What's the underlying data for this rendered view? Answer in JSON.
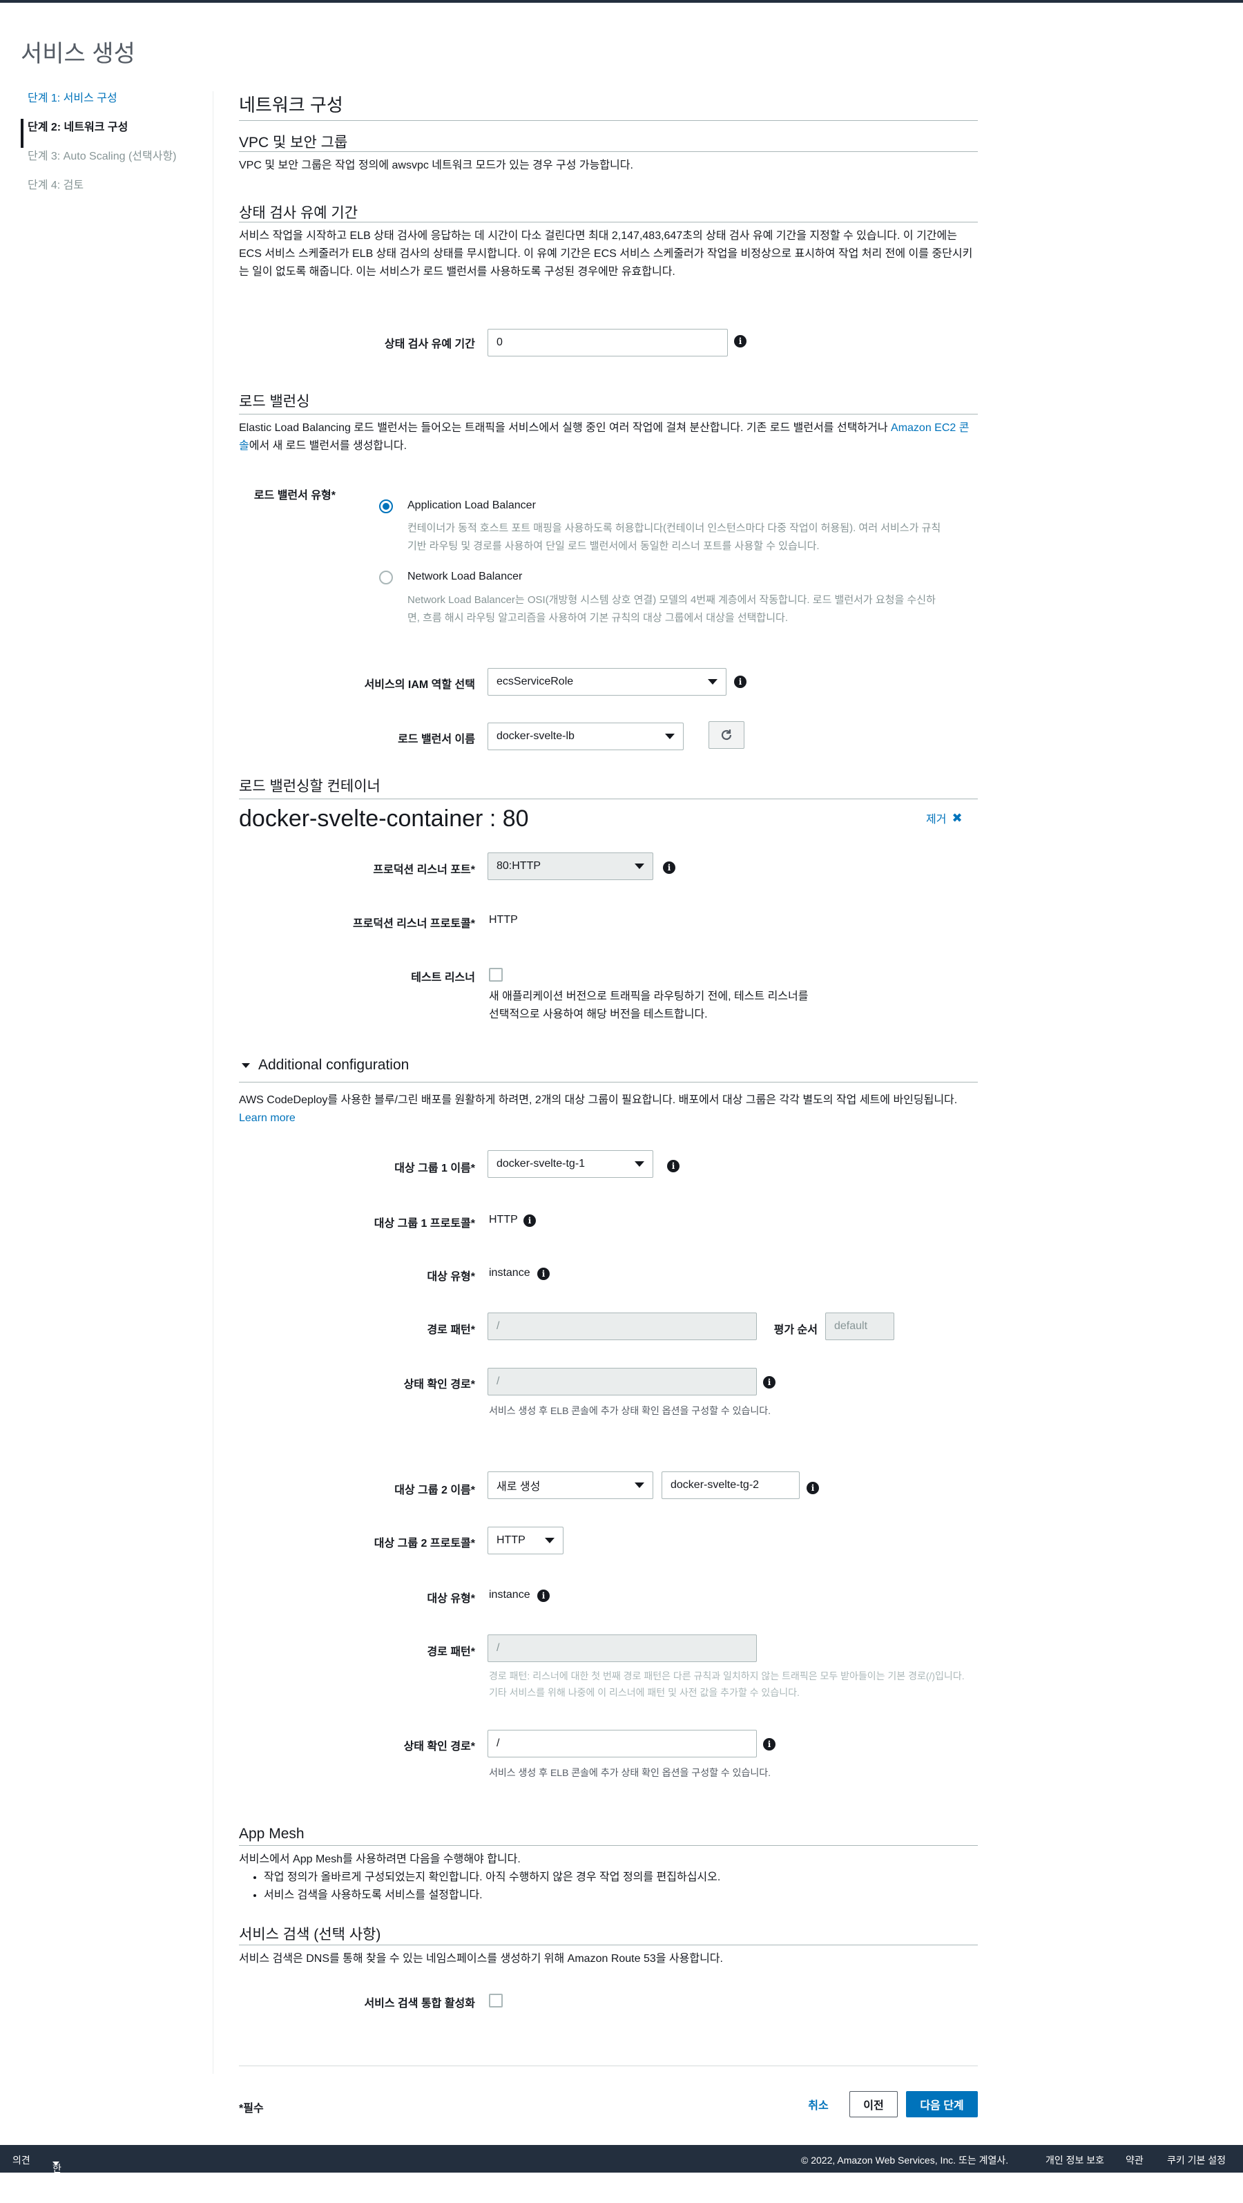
{
  "page_title": "서비스 생성",
  "steps": [
    {
      "label": "단계 1: 서비스 구성"
    },
    {
      "label": "단계 2: 네트워크 구성"
    },
    {
      "label": "단계 3: Auto Scaling (선택사항)"
    },
    {
      "label": "단계 4: 검토"
    }
  ],
  "section_title": "네트워크 구성",
  "vpc": {
    "title": "VPC 및 보안 그룹",
    "desc": "VPC 및 보안 그룹은 작업 정의에 awsvpc 네트워크 모드가 있는 경우 구성 가능합니다."
  },
  "grace": {
    "title": "상태 검사 유예 기간",
    "desc": "서비스 작업을 시작하고 ELB 상태 검사에 응답하는 데 시간이 다소 걸린다면 최대 2,147,483,647초의 상태 검사 유예 기간을 지정할 수 있습니다. 이 기간에는 ECS 서비스 스케줄러가 ELB 상태 검사의 상태를 무시합니다. 이 유예 기간은 ECS 서비스 스케줄러가 작업을 비정상으로 표시하여 작업 처리 전에 이를 중단시키는 일이 없도록 해줍니다. 이는 서비스가 로드 밸런서를 사용하도록 구성된 경우에만 유효합니다.",
    "label": "상태 검사 유예 기간",
    "value": "0",
    "info_icon": "info-icon"
  },
  "lb": {
    "title": "로드 밸런싱",
    "desc_pre": "Elastic Load Balancing 로드 밸런서는 들어오는 트래픽을 서비스에서 실행 중인 여러 작업에 걸쳐 분산합니다. 기존 로드 밸런서를 선택하거나 ",
    "desc_link": "Amazon EC2 콘솔",
    "desc_post": "에서 새 로드 밸런서를 생성합니다.",
    "type_label": "로드 밸런서 유형*",
    "options": [
      {
        "label": "Application Load Balancer",
        "desc": "컨테이너가 동적 호스트 포트 매핑을 사용하도록 허용합니다(컨테이너 인스턴스마다 다중 작업이 허용됨). 여러 서비스가 규칙 기반 라우팅 및 경로를 사용하여 단일 로드 밸런서에서 동일한 리스너 포트를 사용할 수 있습니다.",
        "selected": true
      },
      {
        "label": "Network Load Balancer",
        "desc": "Network Load Balancer는 OSI(개방형 시스템 상호 연결) 모델의 4번째 계층에서 작동합니다. 로드 밸런서가 요청을 수신하면, 흐름 해시 라우팅 알고리즘을 사용하여 기본 규칙의 대상 그룹에서 대상을 선택합니다.",
        "selected": false
      }
    ],
    "iam_label": "서비스의 IAM 역할 선택",
    "iam_value": "ecsServiceRole",
    "name_label": "로드 밸런서 이름",
    "name_value": "docker-svelte-lb",
    "refresh_icon": "refresh-icon"
  },
  "container": {
    "section_title": "로드 밸런싱할 컨테이너",
    "name": "docker-svelte-container : 80",
    "remove_label": "제거",
    "prod_port_label": "프로덕션 리스너 포트*",
    "prod_port_value": "80:HTTP",
    "prod_proto_label": "프로덕션 리스너 프로토콜*",
    "prod_proto_value": "HTTP",
    "test_listener_label": "테스트 리스너",
    "test_listener_help": "새 애플리케이션 버전으로 트래픽을 라우팅하기 전에, 테스트 리스너를 선택적으로 사용하여 해당 버전을 테스트합니다."
  },
  "additional": {
    "title": "Additional configuration",
    "desc": "AWS CodeDeploy를 사용한 블루/그린 배포를 원활하게 하려면, 2개의 대상 그룹이 필요합니다. 배포에서 대상 그룹은 각각 별도의 작업 세트에 바인딩됩니다.",
    "learn_more": "Learn more",
    "tg1_name_label": "대상 그룹 1 이름*",
    "tg1_name_value": "docker-svelte-tg-1",
    "tg1_proto_label": "대상 그룹 1 프로토콜*",
    "tg1_proto_value": "HTTP",
    "target_type_label": "대상 유형*",
    "target_type_value": "instance",
    "path_label": "경로 패턴*",
    "path_value": "/",
    "eval_label": "평가 순서",
    "eval_value": "default",
    "health_label": "상태 확인 경로*",
    "health_value": "/",
    "health_help": "서비스 생성 후 ELB 콘솔에 추가 상태 확인 옵션을 구성할 수 있습니다.",
    "tg2_name_label": "대상 그룹 2 이름*",
    "tg2_select_value": "새로 생성",
    "tg2_name_value": "docker-svelte-tg-2",
    "tg2_proto_label": "대상 그룹 2 프로토콜*",
    "tg2_proto_value": "HTTP",
    "target_type2_label": "대상 유형*",
    "target_type2_value": "instance",
    "path2_label": "경로 패턴*",
    "path2_value": "/",
    "path2_help": "경로 패턴: 리스너에 대한 첫 번째 경로 패턴은 다른 규칙과 일치하지 않는 트래픽은 모두 받아들이는 기본 경로(/)입니다. 기타 서비스를 위해 나중에 이 리스너에 패턴 및 사전 값을 추가할 수 있습니다.",
    "health2_label": "상태 확인 경로*",
    "health2_value": "/",
    "health2_help": "서비스 생성 후 ELB 콘솔에 추가 상태 확인 옵션을 구성할 수 있습니다."
  },
  "appmesh": {
    "title": "App Mesh",
    "desc": "서비스에서 App Mesh를 사용하려면 다음을 수행해야 합니다.",
    "bullets": [
      "작업 정의가 올바르게 구성되었는지 확인합니다. 아직 수행하지 않은 경우 작업 정의를 편집하십시오.",
      "서비스 검색을 사용하도록 서비스를 설정합니다."
    ]
  },
  "discovery": {
    "title": "서비스 검색 (선택 사항)",
    "desc": "서비스 검색은 DNS를 통해 찾을 수 있는 네임스페이스를 생성하기 위해 Amazon Route 53을 사용합니다.",
    "label": "서비스 검색 통합 활성화"
  },
  "actions": {
    "required_note": "*필수",
    "cancel": "취소",
    "previous": "이전",
    "next": "다음 단계"
  },
  "footer": {
    "feedback": "의견",
    "language": "한국어",
    "copyright": "© 2022, Amazon Web Services, Inc. 또는 계열사.",
    "privacy": "개인 정보 보호",
    "terms": "약관",
    "cookies": "쿠키 기본 설정"
  }
}
